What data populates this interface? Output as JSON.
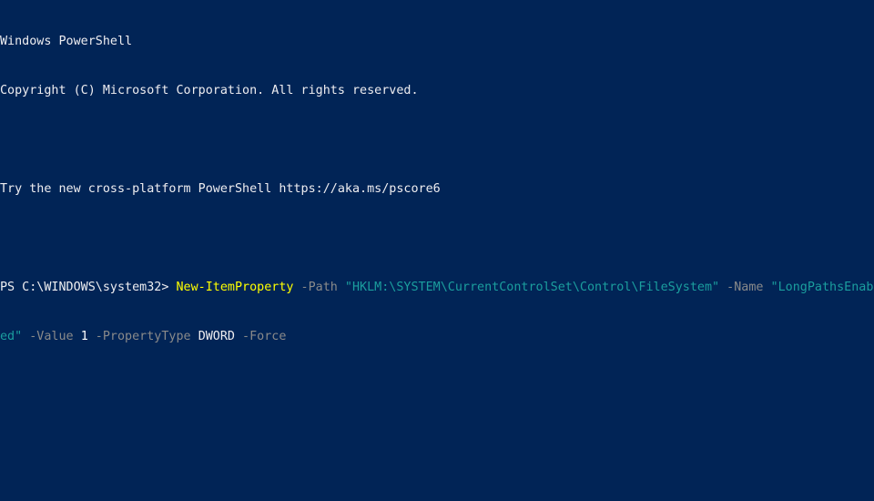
{
  "window": {
    "title": "Windows PowerShell"
  },
  "header_lines": {
    "line1": "Windows PowerShell",
    "line2": "Copyright (C) Microsoft Corporation. All rights reserved.",
    "line3": "Try the new cross-platform PowerShell https://aka.ms/pscore6"
  },
  "command": {
    "prompt": "PS C:\\WINDOWS\\system32> ",
    "cmdlet": "New-ItemProperty",
    "path_param": " -Path ",
    "path_value": "\"HKLM:\\SYSTEM\\CurrentControlSet\\Control\\FileSystem\"",
    "name_param": " -Name ",
    "name_value_part1": "\"LongPathsEnabl",
    "name_value_part2": "ed\"",
    "value_param": " -Value ",
    "value_value": "1",
    "proptype_param": " -PropertyType ",
    "proptype_value": "DWORD",
    "force_param": " -Force"
  },
  "colors": {
    "background": "#012456",
    "foreground": "#eeedf0",
    "cmdlet": "#ffff00",
    "parameter": "#8a8a8a",
    "string": "#1b9e9e"
  }
}
